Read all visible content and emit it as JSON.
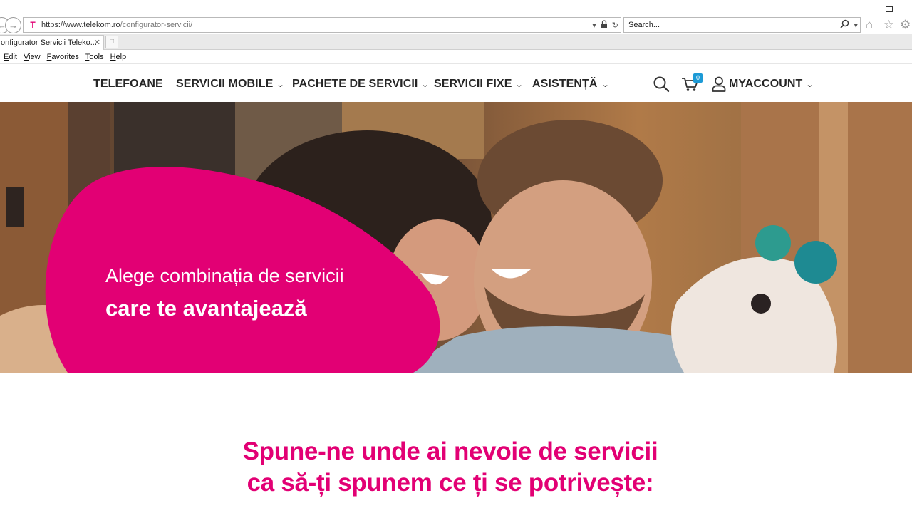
{
  "browser": {
    "url_host": "https://www.telekom.ro",
    "url_path": "/configurator-servicii/",
    "search_placeholder": "Search...",
    "tab_title": "onfigurator Servicii Teleko...",
    "menu": [
      "Edit",
      "View",
      "Favorites",
      "Tools",
      "Help"
    ],
    "icons": [
      "back-icon",
      "forward-icon",
      "lock-icon",
      "refresh-icon",
      "search-icon",
      "home-icon",
      "star-icon",
      "settings-icon"
    ]
  },
  "nav": {
    "items": [
      {
        "label": "TELEFOANE",
        "has_dropdown": false
      },
      {
        "label": "SERVICII MOBILE",
        "has_dropdown": true
      },
      {
        "label": "PACHETE DE SERVICII",
        "has_dropdown": true
      },
      {
        "label": "SERVICII FIXE",
        "has_dropdown": true
      },
      {
        "label": "ASISTENȚĂ",
        "has_dropdown": true
      }
    ],
    "cart_count": "0",
    "account_label": "MYACCOUNT"
  },
  "hero": {
    "line1": "Alege combinația de servicii",
    "line2": "care te avantajează"
  },
  "configurator": {
    "heading_line1": "Spune-ne unde ai nevoie de servicii",
    "heading_line2": "ca să-ți spunem ce ți se potrivește:"
  },
  "colors": {
    "brand_magenta": "#e20074",
    "cart_badge": "#1c9ad6",
    "nav_text": "#262626"
  }
}
